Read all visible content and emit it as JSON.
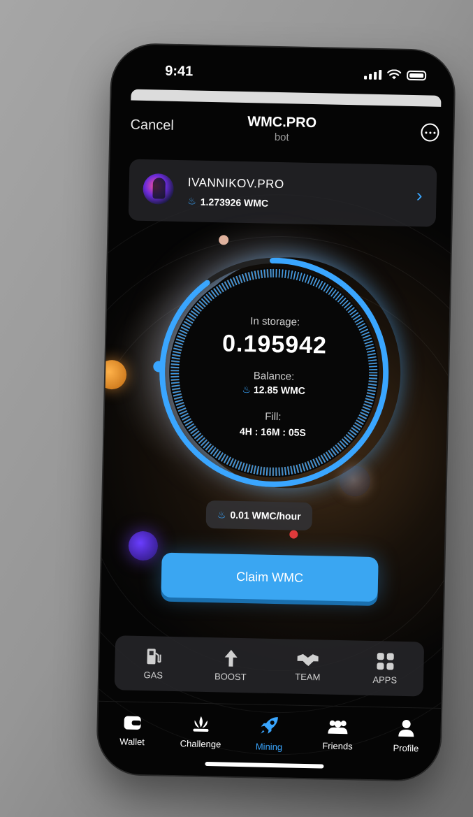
{
  "status_bar": {
    "time": "9:41"
  },
  "header": {
    "cancel_label": "Cancel",
    "title": "WMC.PRO",
    "subtitle": "bot"
  },
  "profile": {
    "name": "IVANNIKOV.PRO",
    "balance": "1.273926 WMC"
  },
  "mining": {
    "storage_label": "In storage:",
    "storage_value": "0.195942",
    "balance_label": "Balance:",
    "balance_value": "12.85 WMC",
    "fill_label": "Fill:",
    "fill_value": "4H : 16M : 05S",
    "fill_progress": 0.9,
    "rate": "0.01 WMC/hour",
    "claim_label": "Claim WMC"
  },
  "quick_actions": [
    {
      "label": "GAS",
      "icon": "fuel-pump-icon"
    },
    {
      "label": "BOOST",
      "icon": "arrow-up-icon"
    },
    {
      "label": "TEAM",
      "icon": "handshake-icon"
    },
    {
      "label": "APPS",
      "icon": "grid-icon"
    }
  ],
  "tabs": [
    {
      "label": "Wallet",
      "icon": "wallet-icon"
    },
    {
      "label": "Challenge",
      "icon": "crown-icon"
    },
    {
      "label": "Mining",
      "icon": "rocket-icon",
      "active": true
    },
    {
      "label": "Friends",
      "icon": "friends-icon"
    },
    {
      "label": "Profile",
      "icon": "person-icon"
    }
  ],
  "colors": {
    "accent": "#3aa6ff",
    "background": "#050505",
    "card": "#28282c"
  }
}
